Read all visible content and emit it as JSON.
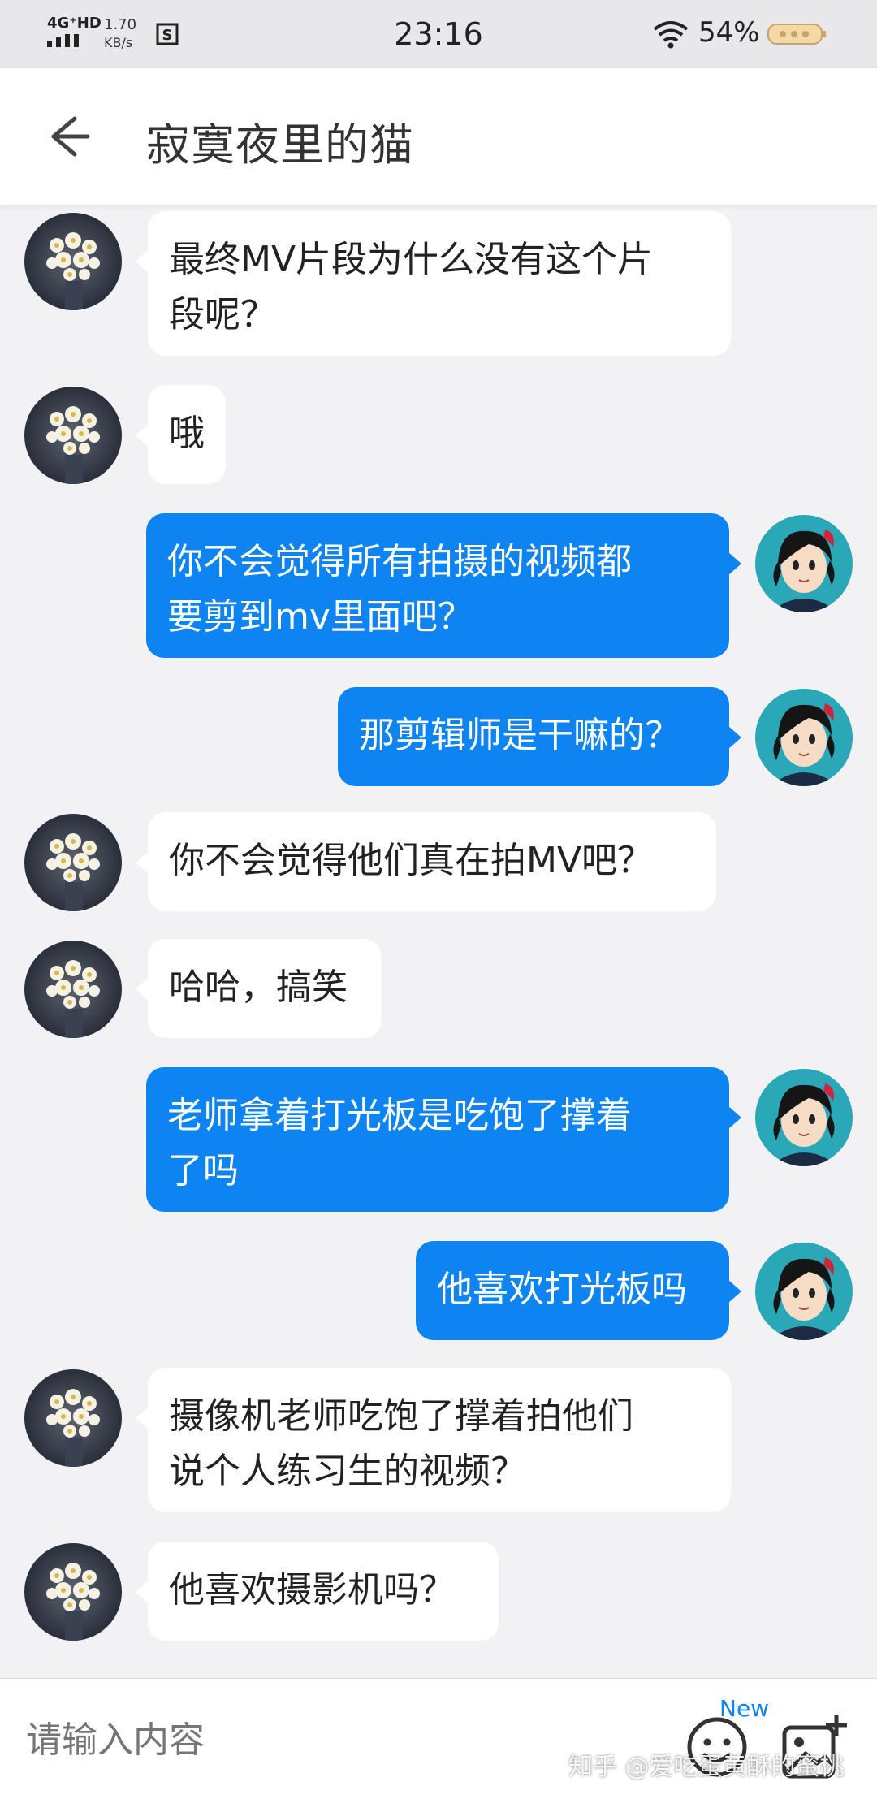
{
  "status_bar": {
    "network": "4G⁺HD",
    "speed_value": "1.70",
    "speed_unit": "KB/s",
    "time": "23:16",
    "battery": "54%"
  },
  "header": {
    "title": "寂寞夜里的猫"
  },
  "messages": [
    {
      "side": "in",
      "text": "最终MV片段为什么没有这个片\n段呢？"
    },
    {
      "side": "in",
      "text": "哦"
    },
    {
      "side": "out",
      "text": "你不会觉得所有拍摄的视频都\n要剪到mv里面吧？"
    },
    {
      "side": "out",
      "text": "那剪辑师是干嘛的？"
    },
    {
      "side": "in",
      "text": "你不会觉得他们真在拍MV吧？"
    },
    {
      "side": "in",
      "text": "哈哈，搞笑"
    },
    {
      "side": "out",
      "text": "老师拿着打光板是吃饱了撑着\n了吗"
    },
    {
      "side": "out",
      "text": "他喜欢打光板吗"
    },
    {
      "side": "in",
      "text": "摄像机老师吃饱了撑着拍他们\n说个人练习生的视频？"
    },
    {
      "side": "in",
      "text": "他喜欢摄影机吗？"
    }
  ],
  "input": {
    "placeholder": "请输入内容",
    "new_badge": "New"
  },
  "watermark": "知乎 @爱吃蛋黄酥的蜜桃",
  "colors": {
    "outgoing_bubble": "#0d84f2",
    "incoming_bubble": "#ffffff",
    "background": "#f2f2f4"
  },
  "icons": {
    "back": "arrow-left-icon",
    "emoji": "emoji-icon",
    "image": "image-add-icon",
    "wifi": "wifi-icon",
    "battery": "battery-icon"
  }
}
